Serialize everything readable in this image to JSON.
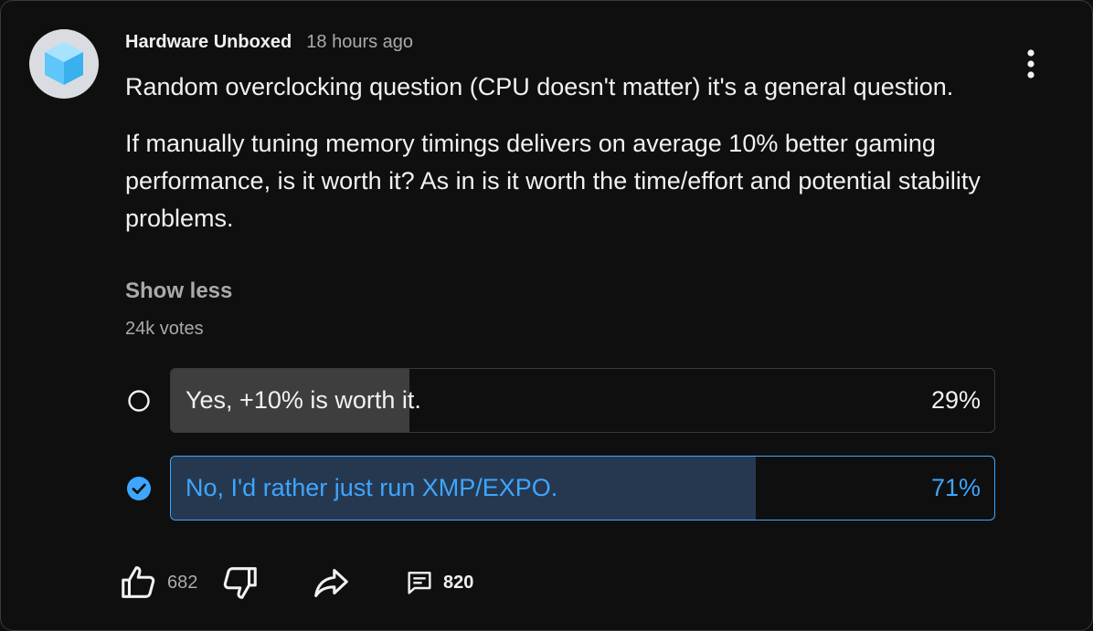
{
  "post": {
    "channel": "Hardware Unboxed",
    "time": "18 hours ago",
    "paragraph1": "Random overclocking question (CPU doesn't matter) it's a general question.",
    "paragraph2": "If manually tuning memory timings delivers on average 10% better gaming performance, is it worth it? As in is it worth the time/effort and potential stability problems.",
    "show_less": "Show less"
  },
  "poll": {
    "votes": "24k votes",
    "options": [
      {
        "label": "Yes, +10% is worth it.",
        "percent_text": "29%",
        "fraction": 0.29,
        "selected": false
      },
      {
        "label": "No, I'd rather just run XMP/EXPO.",
        "percent_text": "71%",
        "fraction": 0.71,
        "selected": true
      }
    ]
  },
  "actions": {
    "likes": "682",
    "comments": "820"
  },
  "colors": {
    "background": "#0f0f0f",
    "text": "#f1f1f1",
    "muted": "#aaaaaa",
    "accent": "#3ea6ff"
  },
  "icons": {
    "avatar": "blue-cube-icon",
    "menu": "more-vert-icon",
    "like": "thumb-up-icon",
    "dislike": "thumb-down-icon",
    "share": "share-icon",
    "comment": "comment-icon",
    "unselected": "radio-unchecked-icon",
    "selected": "check-circle-icon"
  }
}
